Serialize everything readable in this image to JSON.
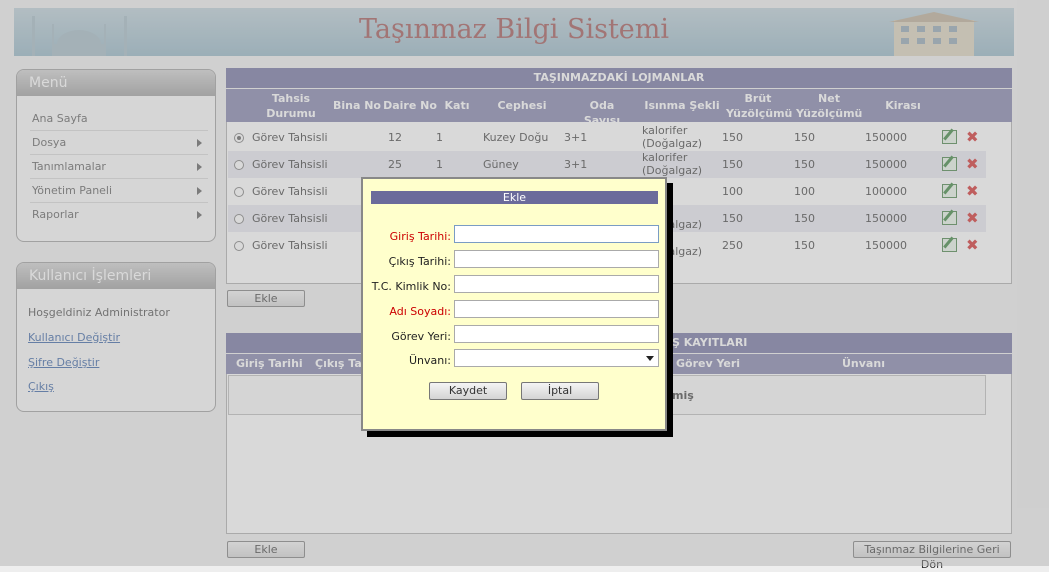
{
  "header": {
    "title": "Taşınmaz Bilgi Sistemi"
  },
  "menu": {
    "title": "Menü",
    "items": [
      {
        "label": "Ana Sayfa"
      },
      {
        "label": "Dosya"
      },
      {
        "label": "Tanımlamalar"
      },
      {
        "label": "Yönetim Paneli"
      },
      {
        "label": "Raporlar"
      }
    ]
  },
  "user": {
    "title": "Kullanıcı İşlemleri",
    "welcome": "Hoşgeldiniz Administrator",
    "links": [
      "Kullanıcı Değiştir",
      "Şifre Değiştir",
      "Çıkış"
    ]
  },
  "lojman": {
    "title": "TAŞINMAZDAKİ LOJMANLAR",
    "columns": [
      "Tahsis Durumu",
      "Bina No",
      "Daire No",
      "Katı",
      "Cephesi",
      "Oda Sayısı",
      "Isınma Şekli",
      "Brüt Yüzölçümü",
      "Net Yüzölçümü",
      "Kirası"
    ],
    "rows": [
      {
        "tahsis": "Görev Tahsisli",
        "bina": "",
        "daire": "12",
        "kat": "1",
        "cephe": "Kuzey Doğu",
        "oda": "3+1",
        "isinma": "kalorifer (Doğalgaz)",
        "brut": "150",
        "net": "150",
        "kira": "150000"
      },
      {
        "tahsis": "Görev Tahsisli",
        "bina": "",
        "daire": "25",
        "kat": "1",
        "cephe": "Güney",
        "oda": "3+1",
        "isinma": "kalorifer (Doğalgaz)",
        "brut": "150",
        "net": "150",
        "kira": "150000"
      },
      {
        "tahsis": "Görev Tahsisli",
        "bina": "",
        "daire": "",
        "kat": "",
        "cephe": "",
        "oda": "",
        "isinma": "er",
        "brut": "100",
        "net": "100",
        "kira": "100000"
      },
      {
        "tahsis": "Görev Tahsisli",
        "bina": "",
        "daire": "",
        "kat": "",
        "cephe": "",
        "oda": "",
        "isinma": "er (Doğalgaz)",
        "brut": "150",
        "net": "150",
        "kira": "150000"
      },
      {
        "tahsis": "Görev Tahsisli",
        "bina": "",
        "daire": "",
        "kat": "",
        "cephe": "",
        "oda": "",
        "isinma": "er (Doğalgaz)",
        "brut": "250",
        "net": "150",
        "kira": "150000"
      }
    ],
    "ekle_label": "Ekle"
  },
  "kayit": {
    "title_visible": "Ş KAYITLARI",
    "columns_visible": [
      "Giriş Tarihi",
      "Çıkış Ta",
      "Görev Yeri",
      "Ünvanı"
    ],
    "empty_fragment": "miş",
    "ekle_label": "Ekle",
    "back_label": "Taşınmaz Bilgilerine Geri Dön"
  },
  "modal": {
    "title": "Ekle",
    "fields": [
      {
        "label": "Giriş Tarihi:",
        "value": ""
      },
      {
        "label": "Çıkış Tarihi:",
        "value": ""
      },
      {
        "label": "T.C. Kimlik No:",
        "value": ""
      },
      {
        "label": "Adı Soyadı:",
        "value": ""
      },
      {
        "label": "Görev Yeri:",
        "value": ""
      },
      {
        "label": "Ünvanı:",
        "value": ""
      }
    ],
    "save_label": "Kaydet",
    "cancel_label": "İptal"
  },
  "colors": {
    "bar": "#6b6b9b",
    "required": "#cc0000",
    "modal_bg": "#ffffcc"
  }
}
